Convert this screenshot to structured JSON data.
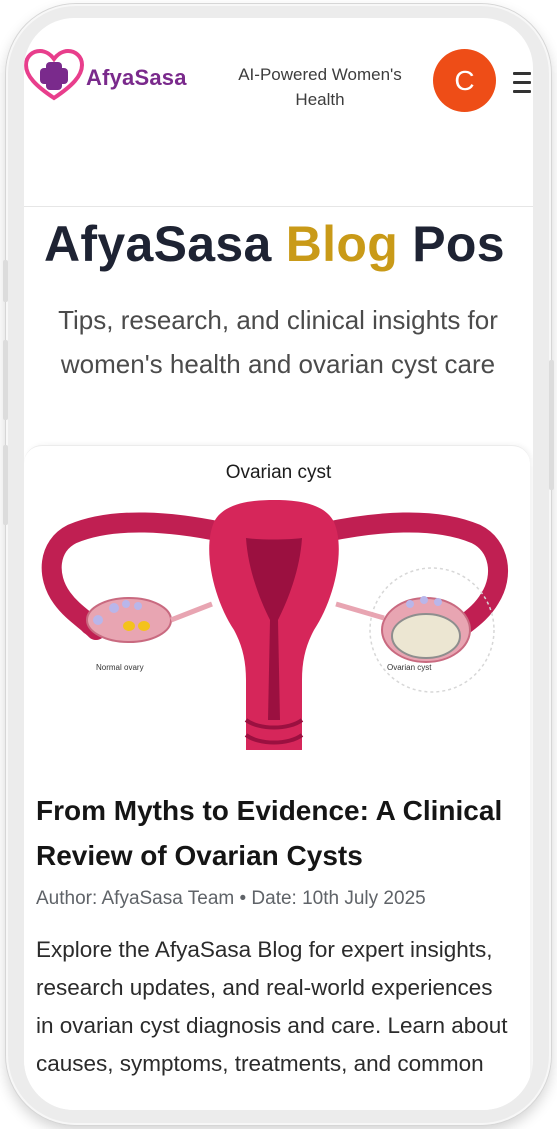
{
  "header": {
    "brand_name": "AfyaSasa",
    "tagline": "AI-Powered Women's Health",
    "avatar_initial": "C",
    "menu_icon": "hamburger-icon"
  },
  "hero": {
    "title_part1": "AfyaSasa ",
    "title_accent": "Blog",
    "title_part2": " Pos",
    "subtitle": "Tips, research, and clinical insights for women's health and ovarian cyst care"
  },
  "post": {
    "image_caption": "Ovarian cyst",
    "label_normal": "Normal ovary",
    "label_cyst": "Ovarian cyst",
    "title": "From Myths to Evidence: A Clinical Review of Ovarian Cysts",
    "meta": "Author: AfyaSasa Team • Date: 10th July 2025",
    "excerpt": "Explore the AfyaSasa Blog for expert insights, research updates, and real-world experiences in ovarian cyst diagnosis and care. Learn about causes, symptoms, treatments, and common"
  },
  "colors": {
    "brand_purple": "#7a2a8c",
    "accent_gold": "#c99a18",
    "avatar_orange": "#ee4d17",
    "uterus_pink": "#d6265a"
  }
}
